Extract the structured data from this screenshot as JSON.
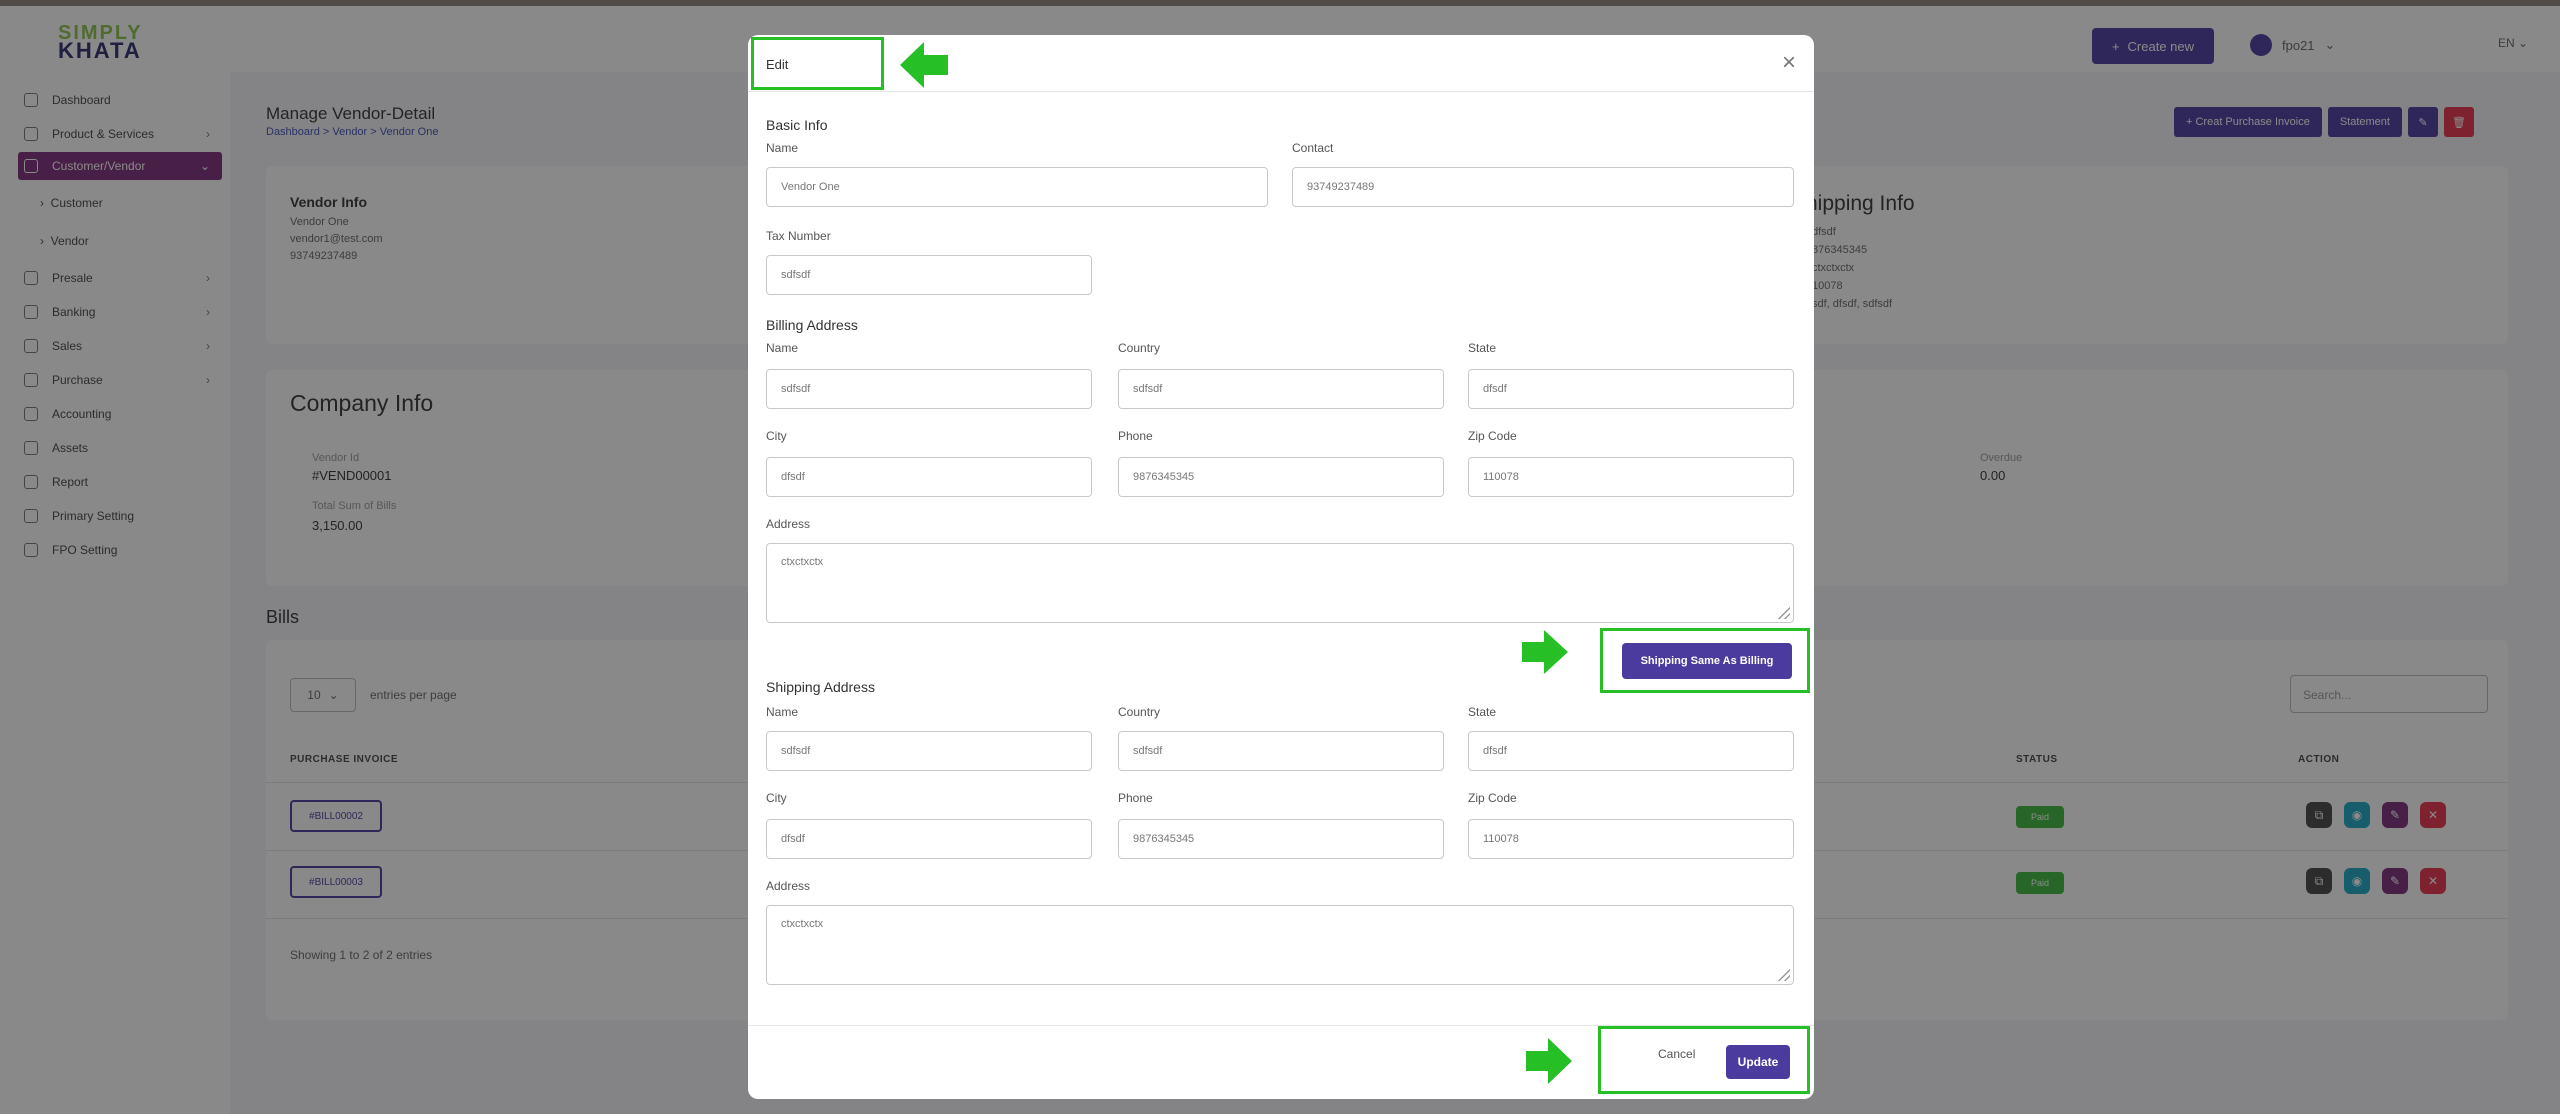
{
  "app": {
    "logo_line1": "SIMPLY",
    "logo_line2": "KHATA"
  },
  "header": {
    "create_label": "Create new",
    "user_name": "fpo21",
    "language": "EN"
  },
  "sidebar": {
    "items": [
      {
        "label": "Dashboard"
      },
      {
        "label": "Product & Services"
      },
      {
        "label": "Customer/Vendor"
      },
      {
        "label": "Customer"
      },
      {
        "label": "Vendor"
      },
      {
        "label": "Presale"
      },
      {
        "label": "Banking"
      },
      {
        "label": "Sales"
      },
      {
        "label": "Purchase"
      },
      {
        "label": "Accounting"
      },
      {
        "label": "Assets"
      },
      {
        "label": "Report"
      },
      {
        "label": "Primary Setting"
      },
      {
        "label": "FPO Setting"
      }
    ]
  },
  "page": {
    "title": "Manage Vendor-Detail",
    "breadcrumb": "Dashboard  >  Vendor  >  Vendor One",
    "btn_purchase": "+ Creat Purchase Invoice",
    "btn_statement": "Statement",
    "vendor_info_title": "Vendor Info",
    "vendor_name": "Vendor One",
    "vendor_email": "vendor1@test.com",
    "vendor_phone": "93749237489",
    "shipping_info_title": "hipping Info",
    "shipping_lines": [
      "dfsdf",
      "876345345",
      "ctxctxctx",
      "10078",
      "sdf, dfsdf, sdfsdf"
    ],
    "company_info_title": "Company Info",
    "vendor_id_label": "Vendor Id",
    "vendor_id": "#VEND00001",
    "total_bills_label": "Total Sum of Bills",
    "total_bills": "3,150.00",
    "overdue_label": "Overdue",
    "overdue": "0.00",
    "bills_title": "Bills",
    "entries_value": "10",
    "entries_label": "entries per page",
    "search_placeholder": "Search...",
    "col_invoice": "PURCHASE INVOICE",
    "col_status": "STATUS",
    "col_action": "ACTION",
    "rows": [
      {
        "invoice": "#BILL00002",
        "status": "Paid"
      },
      {
        "invoice": "#BILL00003",
        "status": "Paid"
      }
    ],
    "showing": "Showing 1 to 2 of 2 entries"
  },
  "modal": {
    "title": "Edit",
    "basic_info": "Basic Info",
    "name_label": "Name",
    "name_value": "Vendor One",
    "contact_label": "Contact",
    "contact_value": "93749237489",
    "tax_label": "Tax Number",
    "tax_value": "sdfsdf",
    "billing_title": "Billing Address",
    "shipping_title": "Shipping Address",
    "country_label": "Country",
    "state_label": "State",
    "city_label": "City",
    "phone_label": "Phone",
    "zip_label": "Zip Code",
    "address_label": "Address",
    "billing": {
      "name": "sdfsdf",
      "country": "sdfsdf",
      "state": "dfsdf",
      "city": "dfsdf",
      "phone": "9876345345",
      "zip": "110078",
      "address": "ctxctxctx"
    },
    "shipping": {
      "name": "sdfsdf",
      "country": "sdfsdf",
      "state": "dfsdf",
      "city": "dfsdf",
      "phone": "9876345345",
      "zip": "110078",
      "address": "ctxctxctx"
    },
    "ship_same_label": "Shipping Same As Billing",
    "cancel_label": "Cancel",
    "update_label": "Update"
  },
  "colors": {
    "accent": "#4b3b9e",
    "highlight": "#26c026",
    "active_nav": "#7b2b7b",
    "danger": "#e8304a",
    "success": "#3cb83c"
  }
}
